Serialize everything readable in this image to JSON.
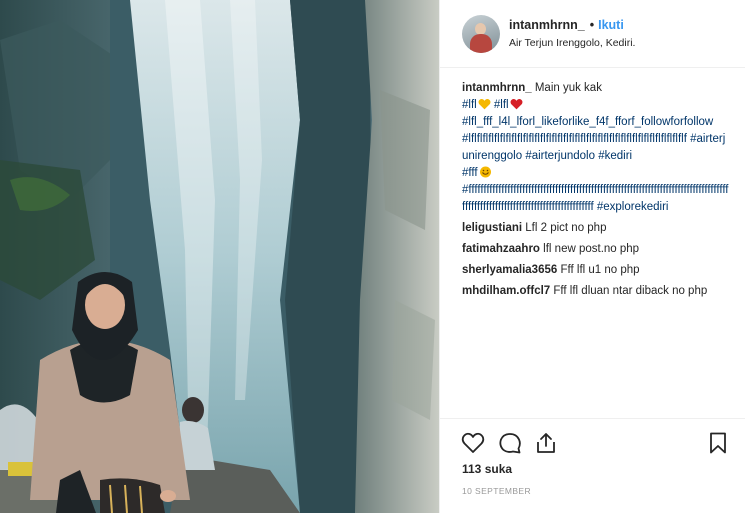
{
  "post": {
    "username": "intanmhrnn_",
    "dot": "•",
    "follow_label": "Ikuti",
    "location": "Air Terjun Irenggolo, Kediri."
  },
  "caption": {
    "username": "intanmhrnn_",
    "text": "Main yuk kak",
    "line2_tag1": "#lfl",
    "line2_tag2": "#lfl",
    "line3": "#lfl_fff_l4l_lforl_likeforlike_f4f_fforf_followforfollow",
    "line4": "#lflflflflflflflflflflflflflflflflflflflflflflflflflflflflflflflflflflflflflf",
    "line5_tag1": "#airterjunirenggolo",
    "line5_tag2": "#airterjundolo",
    "line5_tag3": "#kediri",
    "line6_tag": "#fff",
    "line7": "#fffffffffffffffffffffffffffffffffffffffffffffffffffffffffffffffffffffffffffffffffffffffffffffffffffffffffffffffffffffffffffffffffff",
    "line7_tag2": "#explorekediri"
  },
  "emoji_colors": {
    "yellow_heart": "#f5b800",
    "red_heart": "#d61f26",
    "smile": "#f5b800"
  },
  "comments": [
    {
      "user": "leligustiani",
      "text": "Lfl 2 pict no php"
    },
    {
      "user": "fatimahzaahro",
      "text": "lfl new post.no php"
    },
    {
      "user": "sherlyamalia3656",
      "text": "Fff lfl u1 no php"
    },
    {
      "user": "mhdilham.offcl7",
      "text": "Fff lfl dluan ntar diback no php"
    }
  ],
  "stats": {
    "likes": "113 suka",
    "date": "10 SEPTEMBER"
  },
  "icons": {
    "like": "heart-icon",
    "comment": "comment-icon",
    "share": "share-icon",
    "save": "bookmark-icon"
  },
  "accent": "#3897f0",
  "hashtag_color": "#003569"
}
